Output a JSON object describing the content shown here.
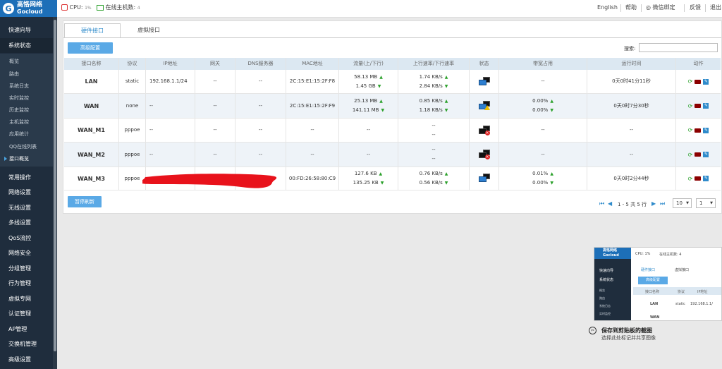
{
  "brand": {
    "name_cn": "高恪网络",
    "name_en": "Gocloud"
  },
  "topbar": {
    "cpu_label": "CPU:",
    "cpu_value": "1%",
    "online_label": "在线主机数:",
    "online_value": "4",
    "links": [
      "English",
      "帮助",
      "微信绑定",
      "反馈",
      "退出"
    ]
  },
  "sidebar": {
    "main_top": [
      "快速向导",
      "系统状态"
    ],
    "sub": [
      "概览",
      "路由",
      "系统日志",
      "实时监控",
      "历史监控",
      "主机监控",
      "应用统计",
      "QQ在线列表",
      "接口概览"
    ],
    "active_sub": "接口概览",
    "main_bottom": [
      "常用操作",
      "网络设置",
      "无线设置",
      "多线设置",
      "QoS流控",
      "网络安全",
      "分组管理",
      "行为管理",
      "虚拟专网",
      "认证管理",
      "AP管理",
      "交换机管理",
      "高级设置"
    ]
  },
  "tabs": [
    "硬件接口",
    "虚拟接口"
  ],
  "toolbar": {
    "advanced_button": "高级配置",
    "search_label": "搜索:",
    "search_value": "",
    "pause_button": "暂停刷新"
  },
  "table": {
    "headers": [
      "接口名称",
      "协议",
      "IP地址",
      "网关",
      "DNS服务器",
      "MAC地址",
      "流量(上/下行)",
      "上行速率/下行速率",
      "状态",
      "带宽占用",
      "运行时间",
      "动作"
    ],
    "rows": [
      {
        "name": "LAN",
        "proto": "static",
        "ip": "192.168.1.1/24",
        "gw": "--",
        "dns": "--",
        "mac": "2C:15:E1:15:2F:F8",
        "traffic_up": "58.13 MB",
        "traffic_down": "1.45 GB",
        "rate_up": "1.74 KB/s",
        "rate_down": "2.84 KB/s",
        "status": "connected",
        "bw_up": "--",
        "bw_down": "",
        "uptime": "0天0时41分11秒"
      },
      {
        "name": "WAN",
        "proto": "none",
        "ip": "--",
        "gw": "--",
        "dns": "--",
        "mac": "2C:15:E1:15:2F:F9",
        "traffic_up": "25.13 MB",
        "traffic_down": "141.11 MB",
        "rate_up": "0.85 KB/s",
        "rate_down": "1.18 KB/s",
        "status": "warning",
        "bw_up": "0.00%",
        "bw_down": "0.00%",
        "uptime": "0天0时7分30秒"
      },
      {
        "name": "WAN_M1",
        "proto": "pppoe",
        "ip": "--",
        "gw": "--",
        "dns": "--",
        "mac": "--",
        "traffic_up": "--",
        "traffic_down": "",
        "rate_up": "--",
        "rate_down": "--",
        "status": "disconnected",
        "bw_up": "--",
        "bw_down": "",
        "uptime": "--"
      },
      {
        "name": "WAN_M2",
        "proto": "pppoe",
        "ip": "--",
        "gw": "--",
        "dns": "--",
        "mac": "--",
        "traffic_up": "--",
        "traffic_down": "",
        "rate_up": "--",
        "rate_down": "--",
        "status": "disconnected",
        "bw_up": "--",
        "bw_down": "",
        "uptime": "--"
      },
      {
        "name": "WAN_M3",
        "proto": "pppoe",
        "ip": "",
        "gw": "",
        "dns": "",
        "mac": "00:FD:26:58:80:C9",
        "traffic_up": "127.6 KB",
        "traffic_down": "135.25 KB",
        "rate_up": "0.76 KB/s",
        "rate_down": "0.56 KB/s",
        "status": "connected",
        "bw_up": "0.01%",
        "bw_down": "0.00%",
        "uptime": "0天0时2分44秒"
      }
    ]
  },
  "pager": {
    "range": "1 - 5 共 5 行",
    "page_size": "10",
    "page": "1"
  },
  "thumbnail": {
    "cpu": "CPU: 1%",
    "online": "在线主机数: 4",
    "tab1": "硬件接口",
    "tab2": "虚拟接口",
    "btn": "高级配置",
    "nav": [
      "快速向导",
      "系统状态"
    ],
    "sub": [
      "概览",
      "路由",
      "系统日志",
      "实时监控"
    ],
    "h1": "接口名称",
    "h2": "协议",
    "h3": "IP地址",
    "row_name": "LAN",
    "row_proto": "static",
    "row_ip": "192.168.1.1/",
    "row2": "WAN"
  },
  "toast": {
    "title": "保存到剪贴板的截图",
    "subtitle": "选择此处标记并共享图像"
  },
  "colors": {
    "accent": "#2f8bcb",
    "sidebar": "#1f2d3d",
    "button": "#5aa9e6",
    "header_row": "#dce8f2"
  }
}
